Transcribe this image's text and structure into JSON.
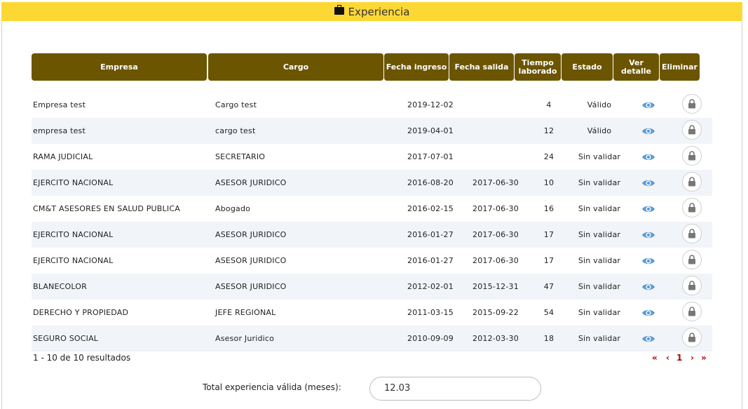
{
  "section": {
    "title": "Experiencia",
    "icon": "briefcase-icon"
  },
  "table": {
    "headers": {
      "empresa": "Empresa",
      "cargo": "Cargo",
      "fecha_ingreso": "Fecha ingreso",
      "fecha_salida": "Fecha salida",
      "tiempo_line1": "Tiempo",
      "tiempo_line2": "laborado",
      "estado": "Estado",
      "ver_detalle": "Ver detalle",
      "eliminar": "Eliminar"
    },
    "rows": [
      {
        "empresa": "Empresa test",
        "cargo": "Cargo test",
        "ingreso": "2019-12-02",
        "salida": "",
        "tiempo": "4",
        "estado": "Válido"
      },
      {
        "empresa": "empresa test",
        "cargo": "cargo test",
        "ingreso": "2019-04-01",
        "salida": "",
        "tiempo": "12",
        "estado": "Válido"
      },
      {
        "empresa": "RAMA JUDICIAL",
        "cargo": "SECRETARIO",
        "ingreso": "2017-07-01",
        "salida": "",
        "tiempo": "24",
        "estado": "Sin validar"
      },
      {
        "empresa": "EJERCITO NACIONAL",
        "cargo": "ASESOR JURIDICO",
        "ingreso": "2016-08-20",
        "salida": "2017-06-30",
        "tiempo": "10",
        "estado": "Sin validar"
      },
      {
        "empresa": "CM&T ASESORES EN SALUD PUBLICA",
        "cargo": "Abogado",
        "ingreso": "2016-02-15",
        "salida": "2017-06-30",
        "tiempo": "16",
        "estado": "Sin validar"
      },
      {
        "empresa": "EJERCITO NACIONAL",
        "cargo": "ASESOR JURIDICO",
        "ingreso": "2016-01-27",
        "salida": "2017-06-30",
        "tiempo": "17",
        "estado": "Sin validar"
      },
      {
        "empresa": "EJERCITO NACIONAL",
        "cargo": "ASESOR JURIDICO",
        "ingreso": "2016-01-27",
        "salida": "2017-06-30",
        "tiempo": "17",
        "estado": "Sin validar"
      },
      {
        "empresa": "BLANECOLOR",
        "cargo": "ASESOR JURIDICO",
        "ingreso": "2012-02-01",
        "salida": "2015-12-31",
        "tiempo": "47",
        "estado": "Sin validar"
      },
      {
        "empresa": "DERECHO Y PROPIEDAD",
        "cargo": "JEFE REGIONAL",
        "ingreso": "2011-03-15",
        "salida": "2015-09-22",
        "tiempo": "54",
        "estado": "Sin validar"
      },
      {
        "empresa": "SEGURO SOCIAL",
        "cargo": "Asesor Juridico",
        "ingreso": "2010-09-09",
        "salida": "2012-03-30",
        "tiempo": "18",
        "estado": "Sin validar"
      }
    ]
  },
  "results_text": "1 - 10 de 10 resultados",
  "pagination": {
    "first": "«",
    "prev": "‹",
    "current": "1",
    "next": "›",
    "last": "»"
  },
  "total": {
    "label": "Total experiencia válida (meses):",
    "value": "12.03"
  },
  "colors": {
    "header_bg": "#fdd835",
    "table_header_bg": "#6b5500",
    "row_alt": "#f1f4f8",
    "eye": "#5b9bd5",
    "pager": "#b00000"
  }
}
